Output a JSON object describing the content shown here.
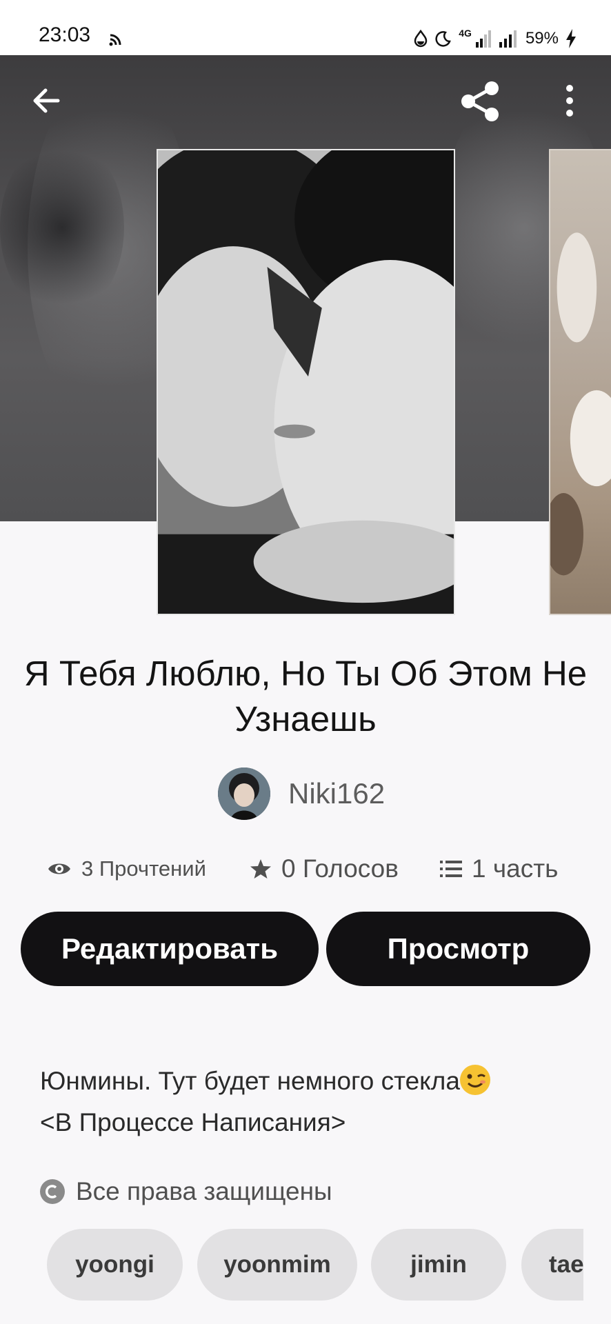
{
  "status_bar": {
    "time": "23:03",
    "network_label": "4G",
    "battery": "59%",
    "icons": [
      "cast-icon",
      "data-saver-icon",
      "moon-icon",
      "signal-icon",
      "signal-icon",
      "charging-icon"
    ]
  },
  "toolbar": {
    "icons": [
      "back-arrow-icon",
      "share-icon",
      "more-vertical-icon"
    ]
  },
  "story": {
    "title": "Я Тебя Люблю, Но Ты Об Этом Не Узнаешь",
    "author": "Niki162",
    "stats": {
      "reads": "3 Прочтений",
      "votes": "0 Голосов",
      "parts": "1 часть"
    },
    "buttons": {
      "edit": "Редактировать",
      "preview": "Просмотр"
    },
    "description_line1": "Юнмины. Тут будет немного стекла",
    "description_line2": "<В Процессе Написания>",
    "rights": "Все права защищены",
    "tags": [
      "yoongi",
      "yoonmim",
      "jimin",
      "tae"
    ]
  },
  "colors": {
    "button_bg": "#121113",
    "tag_bg": "#e2e1e3",
    "page_bg": "#f8f7f9"
  }
}
